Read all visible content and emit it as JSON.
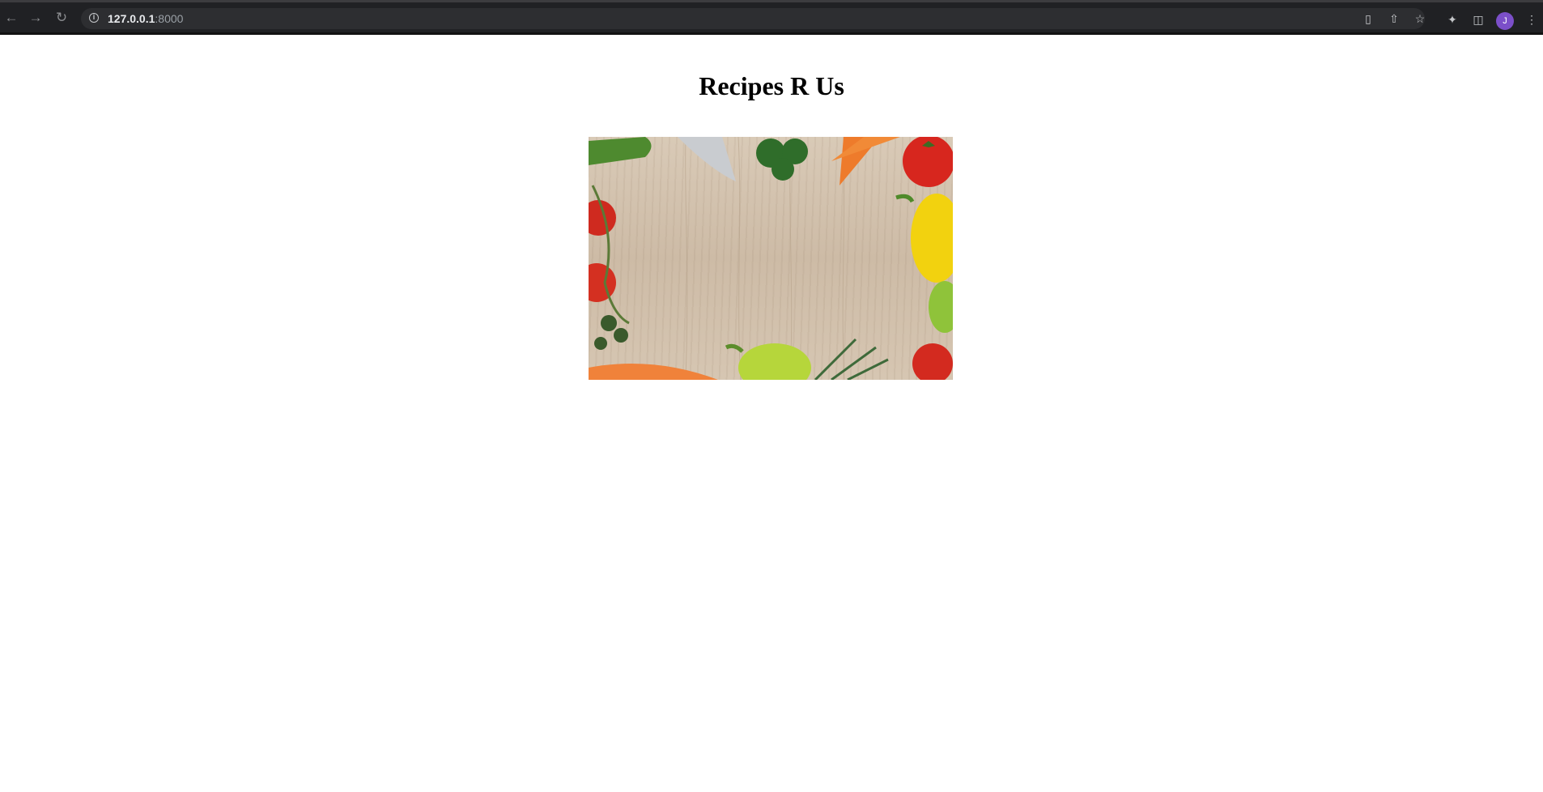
{
  "browser": {
    "url_host": "127.0.0.1",
    "url_port": ":8000",
    "profile_initial": "J"
  },
  "page": {
    "title": "Recipes R Us",
    "hero_image_alt": "Vegetables on a wooden board"
  }
}
